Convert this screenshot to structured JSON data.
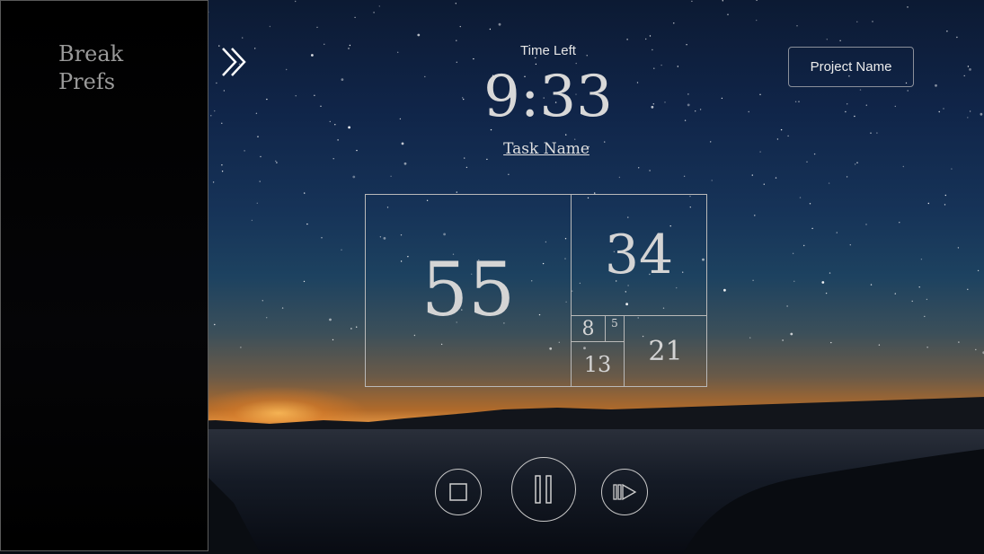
{
  "sidebar": {
    "title": "Break Prefs"
  },
  "header": {
    "time_label": "Time Left",
    "time_value": "9:33",
    "task_name": "Task Name",
    "project_button": "Project Name"
  },
  "fibonacci": {
    "f55": "55",
    "f34": "34",
    "f21": "21",
    "f13": "13",
    "f8": "8",
    "f5": "5"
  },
  "controls": {
    "icons": [
      "stop-icon",
      "pause-icon",
      "skip-forward-icon"
    ]
  },
  "icons": {
    "sidebar_toggle": "double-chevron-right-icon"
  },
  "colors": {
    "text": "#d8d8d8",
    "outline": "#b9b9b9",
    "sidebar_bg": "#000000"
  }
}
